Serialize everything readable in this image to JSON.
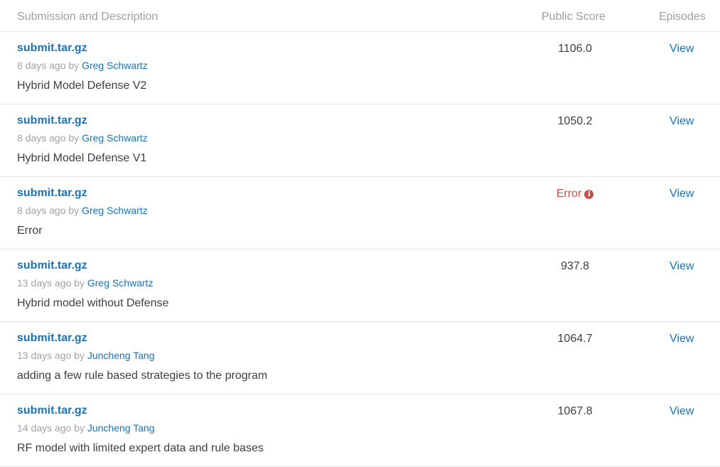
{
  "header": {
    "submission": "Submission and Description",
    "score": "Public Score",
    "episodes": "Episodes"
  },
  "rows": [
    {
      "file": "submit.tar.gz",
      "age": "8 days ago by ",
      "author": "Greg Schwartz",
      "description": "Hybrid Model Defense V2",
      "score": "1106.0",
      "view": "View"
    },
    {
      "file": "submit.tar.gz",
      "age": "8 days ago by ",
      "author": "Greg Schwartz",
      "description": "Hybrid Model Defense V1",
      "score": "1050.2",
      "view": "View"
    },
    {
      "file": "submit.tar.gz",
      "age": "8 days ago by ",
      "author": "Greg Schwartz",
      "description": "Error",
      "score": "Error",
      "view": "View"
    },
    {
      "file": "submit.tar.gz",
      "age": "13 days ago by ",
      "author": "Greg Schwartz",
      "description": "Hybrid model without Defense",
      "score": "937.8",
      "view": "View"
    },
    {
      "file": "submit.tar.gz",
      "age": "13 days ago by ",
      "author": "Juncheng Tang",
      "description": "adding a few rule based strategies to the program",
      "score": "1064.7",
      "view": "View"
    },
    {
      "file": "submit.tar.gz",
      "age": "14 days ago by ",
      "author": "Juncheng Tang",
      "description": "RF model with limited expert data and rule bases",
      "score": "1067.8",
      "view": "View"
    }
  ],
  "colors": {
    "link": "#1a73b8",
    "error": "#c5504b",
    "muted": "#a0a4a8"
  },
  "icons": {
    "error": "info-circle-icon"
  }
}
